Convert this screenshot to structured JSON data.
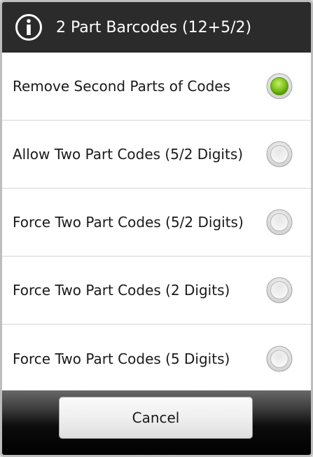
{
  "dialog": {
    "title": "2 Part Barcodes (12+5/2)",
    "title_icon": "info-icon",
    "options": [
      {
        "label": "Remove Second Parts of Codes",
        "selected": true
      },
      {
        "label": "Allow Two Part Codes (5/2 Digits)",
        "selected": false
      },
      {
        "label": "Force Two Part Codes (5/2 Digits)",
        "selected": false
      },
      {
        "label": "Force Two Part Codes (2 Digits)",
        "selected": false
      },
      {
        "label": "Force Two Part Codes (5 Digits)",
        "selected": false
      }
    ],
    "cancel_label": "Cancel"
  },
  "colors": {
    "title_bar": "#2b2b2b",
    "title_text": "#ffffff",
    "radio_selected": "#7dc31a",
    "divider": "#d6d6d6"
  }
}
